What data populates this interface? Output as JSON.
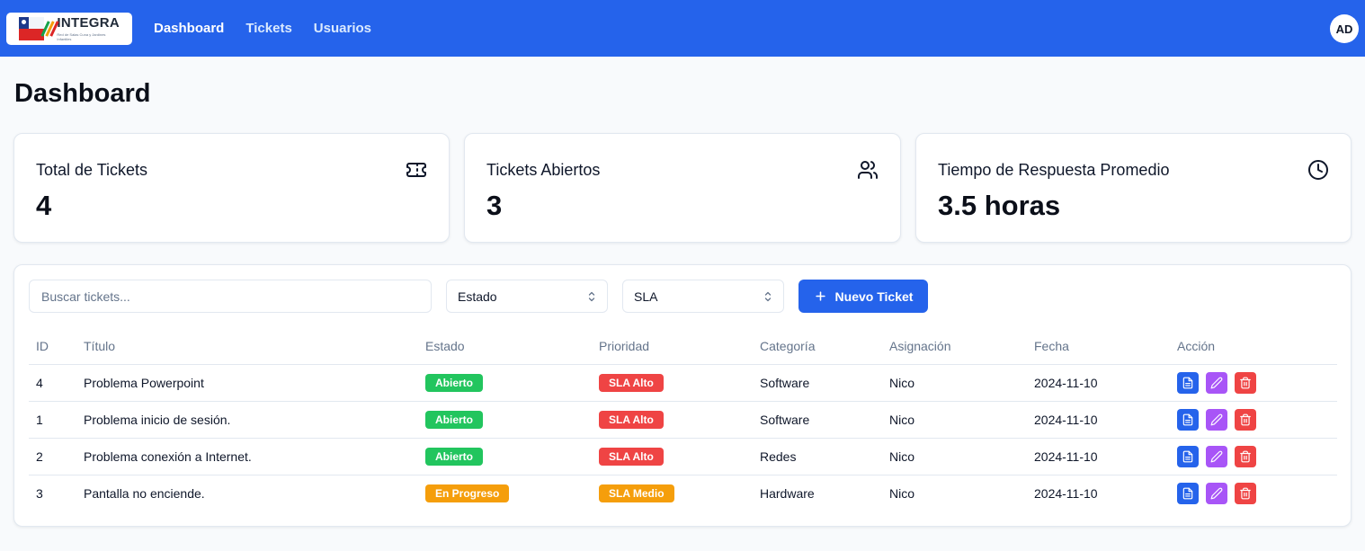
{
  "app": {
    "logo_text": "INTEGRA",
    "logo_subtitle": "Red de Salas Cuna y Jardines Infantiles"
  },
  "nav": {
    "items": [
      {
        "label": "Dashboard",
        "active": true
      },
      {
        "label": "Tickets",
        "active": false
      },
      {
        "label": "Usuarios",
        "active": false
      }
    ],
    "avatar_initials": "AD"
  },
  "page": {
    "title": "Dashboard"
  },
  "stats": [
    {
      "label": "Total de Tickets",
      "value": "4",
      "icon": "ticket-icon"
    },
    {
      "label": "Tickets Abiertos",
      "value": "3",
      "icon": "users-icon"
    },
    {
      "label": "Tiempo de Respuesta Promedio",
      "value": "3.5 horas",
      "icon": "clock-icon"
    }
  ],
  "filters": {
    "search_placeholder": "Buscar tickets...",
    "estado_value": "Estado",
    "sla_value": "SLA",
    "new_ticket_label": "Nuevo Ticket"
  },
  "table": {
    "headers": [
      "ID",
      "Título",
      "Estado",
      "Prioridad",
      "Categoría",
      "Asignación",
      "Fecha",
      "Acción"
    ],
    "rows": [
      {
        "id": "4",
        "title": "Problema Powerpoint",
        "status": "Abierto",
        "status_color": "#22c55e",
        "priority": "SLA Alto",
        "priority_color": "#ef4444",
        "category": "Software",
        "assignee": "Nico",
        "date": "2024-11-10"
      },
      {
        "id": "1",
        "title": "Problema inicio de sesión.",
        "status": "Abierto",
        "status_color": "#22c55e",
        "priority": "SLA Alto",
        "priority_color": "#ef4444",
        "category": "Software",
        "assignee": "Nico",
        "date": "2024-11-10"
      },
      {
        "id": "2",
        "title": "Problema conexión a Internet.",
        "status": "Abierto",
        "status_color": "#22c55e",
        "priority": "SLA Alto",
        "priority_color": "#ef4444",
        "category": "Redes",
        "assignee": "Nico",
        "date": "2024-11-10"
      },
      {
        "id": "3",
        "title": "Pantalla no enciende.",
        "status": "En Progreso",
        "status_color": "#f59e0b",
        "priority": "SLA Medio",
        "priority_color": "#f59e0b",
        "category": "Hardware",
        "assignee": "Nico",
        "date": "2024-11-10"
      }
    ]
  },
  "colors": {
    "brand": "#2563eb",
    "view_action": "#2563eb",
    "edit_action": "#a855f7",
    "delete_action": "#ef4444"
  }
}
